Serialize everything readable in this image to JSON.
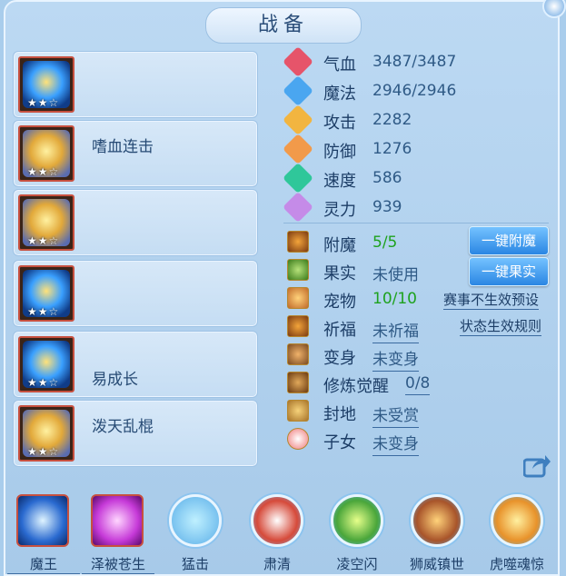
{
  "title": "战备",
  "equipment": [
    {
      "name": "",
      "stars": "★★☆"
    },
    {
      "name": "嗜血连击",
      "stars": "★★☆"
    },
    {
      "name": "",
      "stars": "★★☆"
    },
    {
      "name": "",
      "stars": "★★☆"
    },
    {
      "name": "易成长",
      "stars": "★★☆"
    },
    {
      "name": "泼天乱棍",
      "stars": "★★☆"
    }
  ],
  "stats": [
    {
      "label": "气血",
      "value": "3487/3487",
      "color": "#e6546a"
    },
    {
      "label": "魔法",
      "value": "2946/2946",
      "color": "#4aa6f0"
    },
    {
      "label": "攻击",
      "value": "2282",
      "color": "#f2b540"
    },
    {
      "label": "防御",
      "value": "1276",
      "color": "#f29a4a"
    },
    {
      "label": "速度",
      "value": "586",
      "color": "#2fc79a"
    },
    {
      "label": "灵力",
      "value": "939",
      "color": "#c58be8"
    }
  ],
  "extras": [
    {
      "label": "附魔",
      "value": "5/5"
    },
    {
      "label": "果实",
      "value": "未使用"
    },
    {
      "label": "宠物",
      "value": "10/10"
    },
    {
      "label": "祈福",
      "value": "未祈福"
    },
    {
      "label": "变身",
      "value": "未变身"
    },
    {
      "label": "修炼觉醒",
      "value": "0/8"
    },
    {
      "label": "封地",
      "value": "未受赏"
    },
    {
      "label": "子女",
      "value": "未变身"
    }
  ],
  "buttons": {
    "enchant": "一键附魔",
    "fruit": "一键果实"
  },
  "links": {
    "preset": "赛事不生效预设",
    "rules": "状态生效规则"
  },
  "skills": [
    "魔王",
    "泽被苍生",
    "猛击",
    "肃清",
    "凌空闪",
    "狮威镇世",
    "虎噬魂惊"
  ]
}
